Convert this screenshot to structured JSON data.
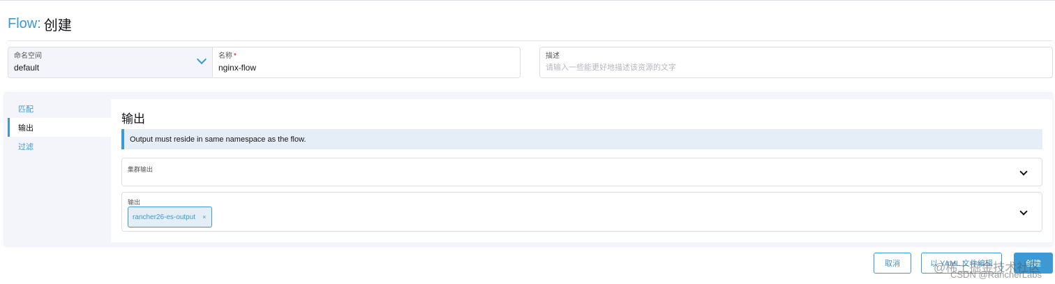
{
  "header": {
    "resource": "Flow",
    "separator": ":",
    "action": "创建"
  },
  "form": {
    "namespace": {
      "label": "命名空间",
      "value": "default"
    },
    "name": {
      "label": "名称",
      "required_mark": "*",
      "value": "nginx-flow"
    },
    "description": {
      "label": "描述",
      "placeholder": "请输入一些能更好地描述该资源的文字"
    }
  },
  "sidetabs": [
    {
      "label": "匹配",
      "active": false
    },
    {
      "label": "输出",
      "active": true
    },
    {
      "label": "过滤",
      "active": false
    }
  ],
  "panel": {
    "title": "输出",
    "banner": "Output must reside in same namespace as the flow.",
    "cluster_outputs": {
      "label": "集群输出"
    },
    "outputs": {
      "label": "输出",
      "selected": [
        "rancher26-es-output"
      ],
      "remove_glyph": "×"
    }
  },
  "footer": {
    "cancel": "取消",
    "edit_yaml": "以 YAML 文件编辑",
    "create": "创建"
  },
  "watermark": {
    "line1": "@稀土掘金技术社区",
    "line2": "CSDN @RancherLabs"
  },
  "colors": {
    "accent": "#3d98d3",
    "banner_bg": "#e5eef7",
    "tab_bg": "#f4f5fa"
  }
}
